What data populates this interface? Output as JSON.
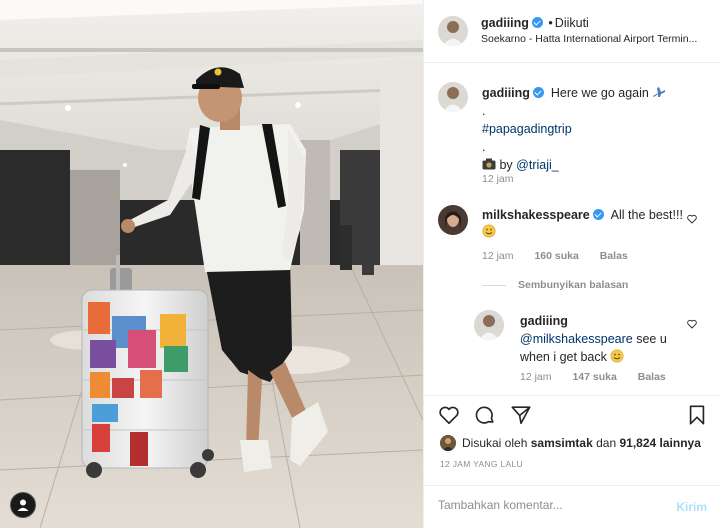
{
  "header": {
    "username": "gadiiing",
    "separator": "•",
    "follow_status": "Diikuti",
    "location": "Soekarno - Hatta International Airport Termin...",
    "more_icon": "more-options-icon"
  },
  "caption": {
    "username": "gadiiing",
    "line1": "Here we go again",
    "line1_emoji_icon": "airplane-icon",
    "dot1": ".",
    "hashtag": "#papagadingtrip",
    "dot2": ".",
    "credit_prefix": "by",
    "credit_icon": "camera-icon",
    "credit_user": "@triaji_",
    "time": "12 jam"
  },
  "comment1": {
    "username": "milkshakesspeare",
    "text": "All the best!!!",
    "emoji_icon": "hugging-face-icon",
    "time": "12 jam",
    "likes": "160 suka",
    "reply": "Balas"
  },
  "hide_replies": "Sembunyikan balasan",
  "reply1": {
    "username": "gadiiing",
    "mention": "@milkshakesspeare",
    "text": "see u when i get back",
    "emoji_icon": "hugging-face-icon",
    "time": "12 jam",
    "likes": "147 suka",
    "reply": "Balas"
  },
  "actions": {
    "icons": [
      "heart-icon",
      "comment-icon",
      "share-icon",
      "bookmark-icon"
    ]
  },
  "likes": {
    "prefix": "Disukai oleh",
    "user": "samsimtak",
    "conjunction": "dan",
    "count": "91,824 lainnya"
  },
  "posted_ago": "12 JAM YANG LALU",
  "add_comment": {
    "placeholder": "Tambahkan komentar...",
    "post_label": "Kirim"
  },
  "colors": {
    "link": "#003569",
    "verified": "#3897f0",
    "muted": "#8e8e8e",
    "post_disabled": "#b2dffc"
  }
}
